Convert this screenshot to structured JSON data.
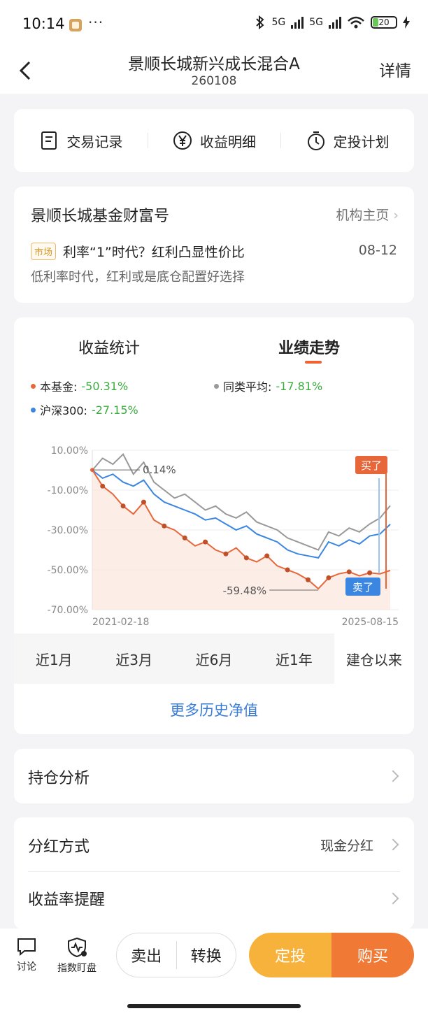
{
  "status_bar": {
    "time": "10:14",
    "dots": "···",
    "net1": "5G",
    "net2": "5G",
    "battery": "20"
  },
  "header": {
    "title": "景顺长城新兴成长混合A",
    "code": "260108",
    "detail_label": "详情"
  },
  "tools": [
    {
      "label": "交易记录",
      "icon": "document-icon"
    },
    {
      "label": "收益明细",
      "icon": "yen-icon"
    },
    {
      "label": "定投计划",
      "icon": "timer-icon"
    }
  ],
  "wealth": {
    "name": "景顺长城基金财富号",
    "home_link": "机构主页",
    "tag": "市场",
    "article_title": "利率“1”时代？红利凸显性价比",
    "date": "08-12",
    "summary": "低利率时代，红利或是底仓配置好选择"
  },
  "performance": {
    "tab_stats": "收益统计",
    "tab_trend": "业绩走势",
    "legend": [
      {
        "name": "本基金:",
        "value": "-50.31%",
        "color": "#e8673a"
      },
      {
        "name": "同类平均:",
        "value": "-17.81%",
        "color": "#999999"
      },
      {
        "name": "沪深300:",
        "value": "-27.15%",
        "color": "#3a86e0"
      }
    ],
    "periods": [
      "近1月",
      "近3月",
      "近6月",
      "近1年",
      "建仓以来"
    ],
    "active_period": "建仓以来",
    "more_link": "更多历史净值"
  },
  "chart_data": {
    "type": "line",
    "x_start": "2021-02-18",
    "x_end": "2025-08-15",
    "y_ticks": [
      "10.00%",
      "-10.00%",
      "-30.00%",
      "-50.00%",
      "-70.00%"
    ],
    "ylim": [
      -70,
      10
    ],
    "annotations": {
      "max_label": "0.14%",
      "max_value": 0.14,
      "min_label": "-59.48%",
      "min_value": -59.48,
      "buy_label": "买了",
      "sell_label": "卖了"
    },
    "series": [
      {
        "name": "本基金",
        "color": "#e8673a",
        "values": [
          0.14,
          -8,
          -12,
          -18,
          -22,
          -16,
          -25,
          -28,
          -30,
          -34,
          -38,
          -36,
          -40,
          -42,
          -39,
          -44,
          -46,
          -43,
          -48,
          -50,
          -52,
          -55,
          -59.48,
          -54,
          -52,
          -51,
          -53,
          -51.5,
          -52,
          -50.31
        ]
      },
      {
        "name": "同类平均",
        "color": "#999999",
        "values": [
          0,
          6,
          3,
          8,
          -2,
          4,
          -6,
          -10,
          -14,
          -12,
          -16,
          -20,
          -18,
          -22,
          -24,
          -21,
          -26,
          -28,
          -30,
          -34,
          -36,
          -38,
          -40,
          -31,
          -33,
          -29,
          -31,
          -27,
          -24,
          -17.81
        ]
      },
      {
        "name": "沪深300",
        "color": "#3a86e0",
        "values": [
          0,
          -4,
          -2,
          -6,
          -8,
          -5,
          -12,
          -16,
          -18,
          -20,
          -22,
          -25,
          -24,
          -27,
          -30,
          -28,
          -32,
          -34,
          -36,
          -40,
          -42,
          -43,
          -44,
          -36,
          -38,
          -35,
          -37,
          -33,
          -32,
          -27.15
        ]
      }
    ]
  },
  "holdings": {
    "label": "持仓分析"
  },
  "settings": {
    "dividend_label": "分红方式",
    "dividend_value": "现金分红",
    "alert_label": "收益率提醒"
  },
  "bottom_bar": {
    "discuss_label": "讨论",
    "watch_label": "指数盯盘",
    "sell_label": "卖出",
    "convert_label": "转换",
    "fixed_label": "定投",
    "buy_label": "购买"
  }
}
